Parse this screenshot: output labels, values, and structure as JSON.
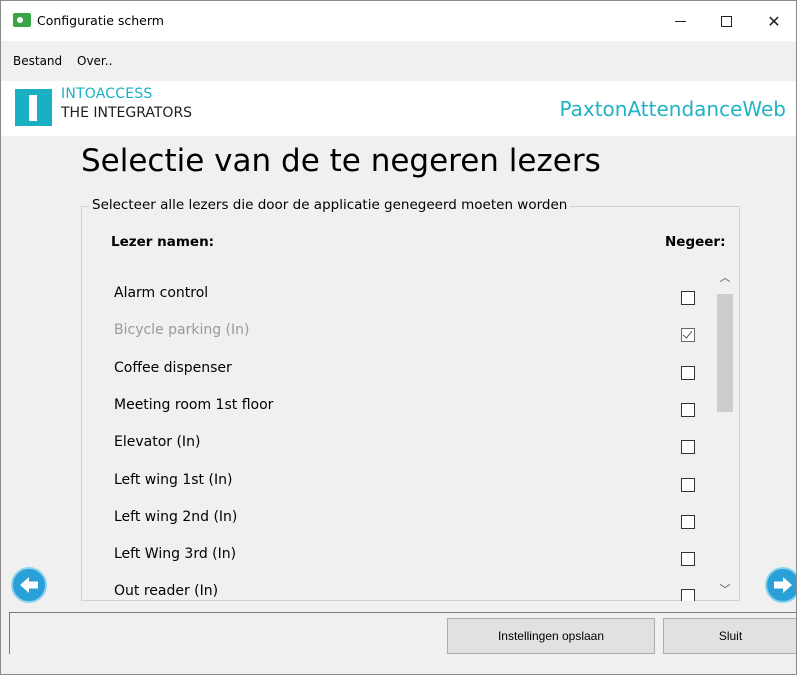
{
  "window": {
    "title": "Configuratie scherm"
  },
  "menu": {
    "items": [
      "Bestand",
      "Over.."
    ]
  },
  "header": {
    "logo_line1": "INTOACCESS",
    "logo_line2": "THE INTEGRATORS",
    "product_name": "PaxtonAttendanceWeb"
  },
  "page": {
    "title": "Selectie van de te negeren lezers",
    "group_caption": "Selecteer alle lezers die door de applicatie genegeerd moeten worden",
    "col_name": "Lezer namen:",
    "col_ignore": "Negeer:"
  },
  "readers": [
    {
      "name": "Alarm control",
      "ignored": false,
      "disabled": false
    },
    {
      "name": "Bicycle parking (In)",
      "ignored": true,
      "disabled": true
    },
    {
      "name": "Coffee dispenser",
      "ignored": false,
      "disabled": false
    },
    {
      "name": "Meeting room 1st floor",
      "ignored": false,
      "disabled": false
    },
    {
      "name": "Elevator (In)",
      "ignored": false,
      "disabled": false
    },
    {
      "name": "Left wing 1st (In)",
      "ignored": false,
      "disabled": false
    },
    {
      "name": "Left wing 2nd (In)",
      "ignored": false,
      "disabled": false
    },
    {
      "name": "Left Wing 3rd (In)",
      "ignored": false,
      "disabled": false
    },
    {
      "name": "Out reader (In)",
      "ignored": false,
      "disabled": false
    }
  ],
  "buttons": {
    "save": "Instellingen opslaan",
    "close": "Sluit"
  },
  "colors": {
    "accent": "#1ab0c4",
    "nav_arrow": "#2aa0d8"
  },
  "icons": {
    "app": "app-icon",
    "prev": "arrow-left-icon",
    "next": "arrow-right-icon"
  }
}
